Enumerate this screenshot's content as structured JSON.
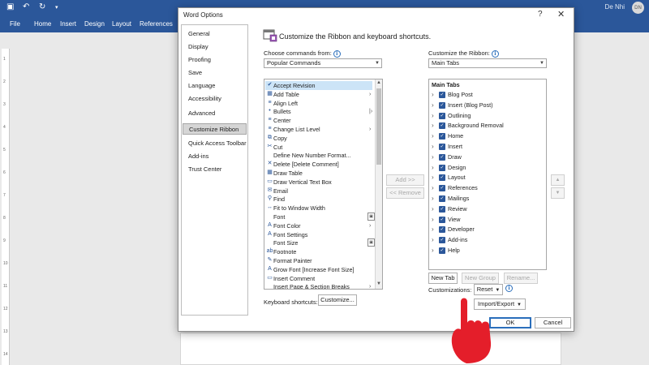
{
  "word": {
    "tabs": [
      "File",
      "Home",
      "Insert",
      "Design",
      "Layout",
      "References"
    ],
    "user_name": "De Nhi",
    "user_initials": "DN",
    "ruler_numbers": [
      "1",
      "2",
      "3",
      "4",
      "5",
      "6",
      "7",
      "8",
      "9",
      "10",
      "11",
      "12",
      "13",
      "14"
    ]
  },
  "dialog": {
    "title": "Word Options",
    "help_label": "?",
    "close_label": "✕",
    "nav_items": [
      "General",
      "Display",
      "Proofing",
      "Save",
      "Language",
      "Accessibility",
      "Advanced",
      "Customize Ribbon",
      "Quick Access Toolbar",
      "Add-ins",
      "Trust Center"
    ],
    "selected_nav": "Customize Ribbon",
    "header": "Customize the Ribbon and keyboard shortcuts.",
    "choose_label": "Choose commands from:",
    "choose_value": "Popular Commands",
    "customize_label": "Customize the Ribbon:",
    "customize_value": "Main Tabs",
    "commands": [
      {
        "label": "Accept Revision",
        "icon": "✔",
        "marker": ""
      },
      {
        "label": "Add Table",
        "icon": "▦",
        "marker": "›"
      },
      {
        "label": "Align Left",
        "icon": "≡",
        "marker": ""
      },
      {
        "label": "Bullets",
        "icon": "•",
        "marker": "|›"
      },
      {
        "label": "Center",
        "icon": "≡",
        "marker": ""
      },
      {
        "label": "Change List Level",
        "icon": "≡",
        "marker": "›"
      },
      {
        "label": "Copy",
        "icon": "⧉",
        "marker": ""
      },
      {
        "label": "Cut",
        "icon": "✂",
        "marker": ""
      },
      {
        "label": "Define New Number Format...",
        "icon": "",
        "marker": ""
      },
      {
        "label": "Delete [Delete Comment]",
        "icon": "✕",
        "marker": ""
      },
      {
        "label": "Draw Table",
        "icon": "▦",
        "marker": ""
      },
      {
        "label": "Draw Vertical Text Box",
        "icon": "▭",
        "marker": ""
      },
      {
        "label": "Email",
        "icon": "✉",
        "marker": ""
      },
      {
        "label": "Find",
        "icon": "⚲",
        "marker": ""
      },
      {
        "label": "Fit to Window Width",
        "icon": "↔",
        "marker": ""
      },
      {
        "label": "Font",
        "icon": "",
        "marker": "▣"
      },
      {
        "label": "Font Color",
        "icon": "A",
        "marker": "›"
      },
      {
        "label": "Font Settings",
        "icon": "A",
        "marker": ""
      },
      {
        "label": "Font Size",
        "icon": "",
        "marker": "▣"
      },
      {
        "label": "Footnote",
        "icon": "ab",
        "marker": ""
      },
      {
        "label": "Format Painter",
        "icon": "✎",
        "marker": ""
      },
      {
        "label": "Grow Font [Increase Font Size]",
        "icon": "A",
        "marker": ""
      },
      {
        "label": "Insert Comment",
        "icon": "▭",
        "marker": ""
      },
      {
        "label": "Insert Page & Section Breaks",
        "icon": "",
        "marker": "›"
      }
    ],
    "tabs_header": "Main Tabs",
    "main_tabs": [
      "Blog Post",
      "Insert (Blog Post)",
      "Outlining",
      "Background Removal",
      "Home",
      "Insert",
      "Draw",
      "Design",
      "Layout",
      "References",
      "Mailings",
      "Review",
      "View",
      "Developer",
      "Add-ins",
      "Help"
    ],
    "add_button": "Add >>",
    "remove_button": "<< Remove",
    "new_tab_button": "New Tab",
    "new_group_button": "New Group",
    "rename_button": "Rename...",
    "customizations_label": "Customizations:",
    "reset_button": "Reset",
    "import_export_button": "Import/Export",
    "keyboard_label": "Keyboard shortcuts:",
    "customize_button": "Customize...",
    "ok_button": "OK",
    "cancel_button": "Cancel"
  },
  "colors": {
    "title_bar": "#2b579a",
    "accent": "#2a6ebb",
    "pointer": "#e41e2a"
  }
}
